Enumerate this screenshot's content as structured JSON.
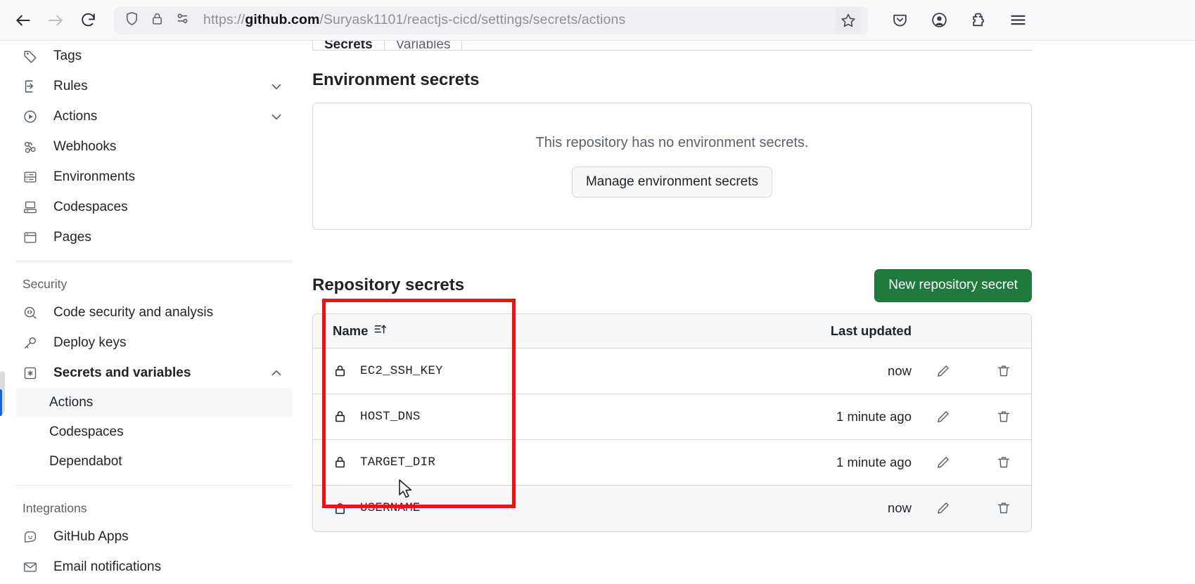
{
  "browser": {
    "url_prefix": "https://",
    "url_host": "github.com",
    "url_path": "/Suryask1101/reactjs-cicd/settings/secrets/actions",
    "back_icon": "back-arrow-icon",
    "forward_icon": "forward-arrow-icon",
    "reload_icon": "reload-icon",
    "shield_icon": "shield-icon",
    "lock_icon": "padlock-icon",
    "permissions_icon": "site-permissions-icon",
    "bookmark_icon": "star-icon",
    "pocket_icon": "pocket-save-icon",
    "account_icon": "account-icon",
    "extensions_icon": "extensions-puzzle-icon",
    "menu_icon": "hamburger-menu-icon"
  },
  "sidebar": {
    "items": [
      {
        "label": "Tags",
        "icon": "tag-icon",
        "chevron": ""
      },
      {
        "label": "Rules",
        "icon": "rules-icon",
        "chevron": "down"
      },
      {
        "label": "Actions",
        "icon": "play-circle-icon",
        "chevron": "down"
      },
      {
        "label": "Webhooks",
        "icon": "webhook-icon",
        "chevron": ""
      },
      {
        "label": "Environments",
        "icon": "server-icon",
        "chevron": ""
      },
      {
        "label": "Codespaces",
        "icon": "codespaces-icon",
        "chevron": ""
      },
      {
        "label": "Pages",
        "icon": "browser-window-icon",
        "chevron": ""
      }
    ],
    "security_heading": "Security",
    "security_items": [
      {
        "label": "Code security and analysis",
        "icon": "code-scan-icon",
        "chevron": ""
      },
      {
        "label": "Deploy keys",
        "icon": "key-icon",
        "chevron": ""
      },
      {
        "label": "Secrets and variables",
        "icon": "asterisk-box-icon",
        "chevron": "up"
      }
    ],
    "secrets_subitems": [
      {
        "label": "Actions",
        "selected": true
      },
      {
        "label": "Codespaces",
        "selected": false
      },
      {
        "label": "Dependabot",
        "selected": false
      }
    ],
    "integrations_heading": "Integrations",
    "integration_items": [
      {
        "label": "GitHub Apps",
        "icon": "github-apps-icon"
      },
      {
        "label": "Email notifications",
        "icon": "envelope-icon"
      }
    ]
  },
  "main": {
    "tabs": [
      {
        "label": "Secrets",
        "active": true
      },
      {
        "label": "Variables",
        "active": false
      }
    ],
    "environment_secrets": {
      "title": "Environment secrets",
      "empty_message": "This repository has no environment secrets.",
      "manage_button": "Manage environment secrets"
    },
    "repository_secrets": {
      "title": "Repository secrets",
      "new_button": "New repository secret",
      "columns": {
        "name": "Name",
        "sort_icon": "sort-ascending-icon",
        "last_updated": "Last updated"
      },
      "rows": [
        {
          "lock_icon": "lock-icon",
          "name": "EC2_SSH_KEY",
          "last_updated": "now",
          "edit_icon": "pencil-icon",
          "delete_icon": "trash-icon",
          "hovered": false
        },
        {
          "lock_icon": "lock-icon",
          "name": "HOST_DNS",
          "last_updated": "1 minute ago",
          "edit_icon": "pencil-icon",
          "delete_icon": "trash-icon",
          "hovered": false
        },
        {
          "lock_icon": "lock-icon",
          "name": "TARGET_DIR",
          "last_updated": "1 minute ago",
          "edit_icon": "pencil-icon",
          "delete_icon": "trash-icon",
          "hovered": false
        },
        {
          "lock_icon": "lock-icon",
          "name": "USERNAME",
          "last_updated": "now",
          "edit_icon": "pencil-icon",
          "delete_icon": "trash-icon",
          "hovered": true
        }
      ]
    }
  },
  "annotation": {
    "highlight_color": "#ee1111",
    "cursor_icon": "mouse-pointer-icon"
  },
  "colors": {
    "primary_green": "#1f7a3d",
    "accent_blue": "#0969da",
    "border": "#d1d9e0",
    "muted_text": "#59636e"
  }
}
